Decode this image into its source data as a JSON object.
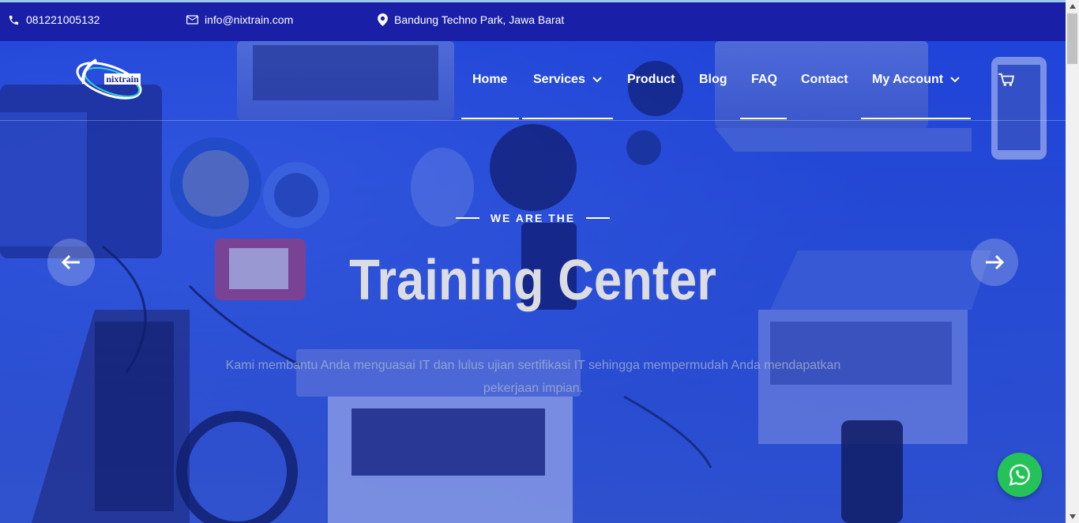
{
  "topbar": {
    "phone": "081221005132",
    "email": "info@nixtrain.com",
    "location": "Bandung Techno Park, Jawa Barat"
  },
  "brand": {
    "logo_text": "nixtrain"
  },
  "nav": {
    "items": [
      {
        "label": "Home"
      },
      {
        "label": "Services"
      },
      {
        "label": "Product"
      },
      {
        "label": "Blog"
      },
      {
        "label": "FAQ"
      },
      {
        "label": "Contact"
      },
      {
        "label": "My Account"
      }
    ]
  },
  "hero": {
    "eyebrow": "WE ARE THE",
    "headline": "Training Center",
    "description": "Kami membantu Anda menguasai IT dan lulus ujian sertifikasi IT sehingga mempermudah Anda mendapatkan pekerjaan impian."
  },
  "icons": {
    "phone": "phone-icon",
    "email": "envelope-icon",
    "location": "map-pin-icon",
    "cart": "cart-icon",
    "prev": "arrow-left-icon",
    "next": "arrow-right-icon",
    "whatsapp": "whatsapp-icon"
  },
  "colors": {
    "topbar": "#1a1fa8",
    "hero_overlay": "#2147d8",
    "whatsapp": "#25c25a"
  }
}
